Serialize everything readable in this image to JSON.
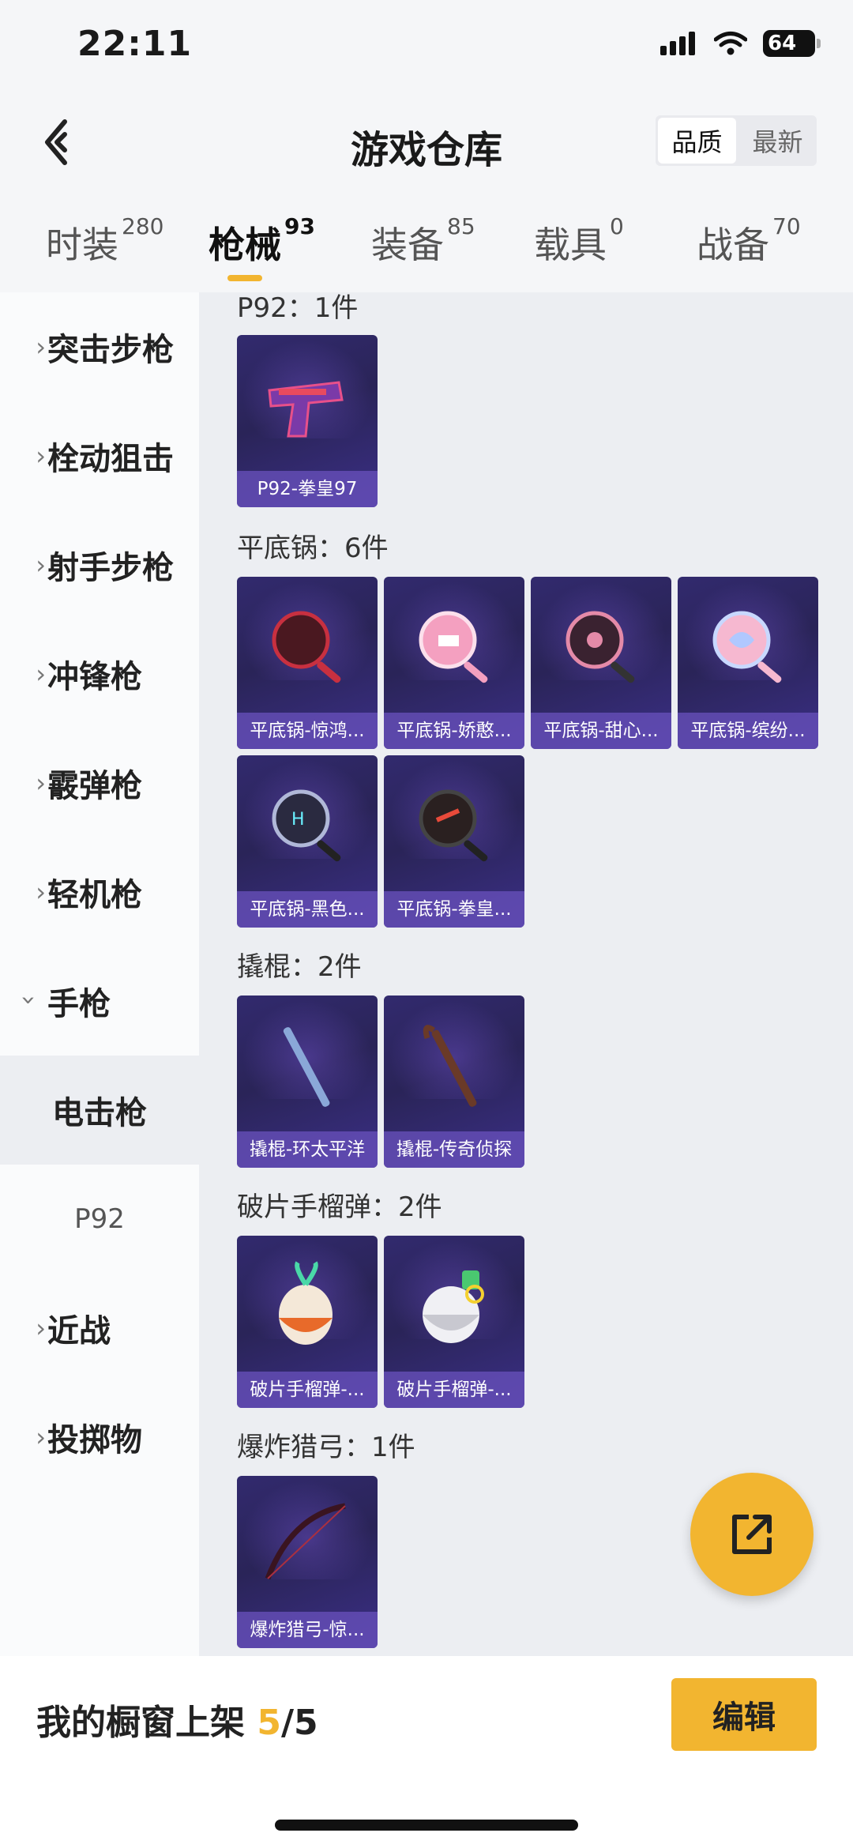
{
  "status": {
    "time": "22:11",
    "battery": "64"
  },
  "header": {
    "title": "游戏仓库",
    "sort_quality": "品质",
    "sort_newest": "最新"
  },
  "tabs": [
    {
      "label": "时装",
      "count": "280"
    },
    {
      "label": "枪械",
      "count": "93"
    },
    {
      "label": "装备",
      "count": "85"
    },
    {
      "label": "载具",
      "count": "0"
    },
    {
      "label": "战备",
      "count": "70"
    }
  ],
  "sidebar": {
    "items": [
      "突击步枪",
      "栓动狙击",
      "射手步枪",
      "冲锋枪",
      "霰弹枪",
      "轻机枪",
      "手枪"
    ],
    "sub_item": "电击枪",
    "sub_item2": "P92",
    "lower_items": [
      "近战",
      "投掷物"
    ]
  },
  "groups": [
    {
      "title": "P92：1件",
      "items": [
        "P92-拳皇97"
      ]
    },
    {
      "title": "平底锅：6件",
      "items": [
        "平底锅-惊鸿...",
        "平底锅-娇憨...",
        "平底锅-甜心...",
        "平底锅-缤纷...",
        "平底锅-黑色...",
        "平底锅-拳皇..."
      ]
    },
    {
      "title": "撬棍：2件",
      "items": [
        "撬棍-环太平洋",
        "撬棍-传奇侦探"
      ]
    },
    {
      "title": "破片手榴弹：2件",
      "items": [
        "破片手榴弹-...",
        "破片手榴弹-..."
      ]
    },
    {
      "title": "爆炸猎弓：1件",
      "items": [
        "爆炸猎弓-惊..."
      ]
    }
  ],
  "bottom": {
    "showcase_label": "我的橱窗上架",
    "showcase_current": "5",
    "showcase_total": "/5",
    "edit_label": "编辑"
  },
  "colors": {
    "accent": "#f2b530",
    "card_bg": "#2f2866"
  }
}
